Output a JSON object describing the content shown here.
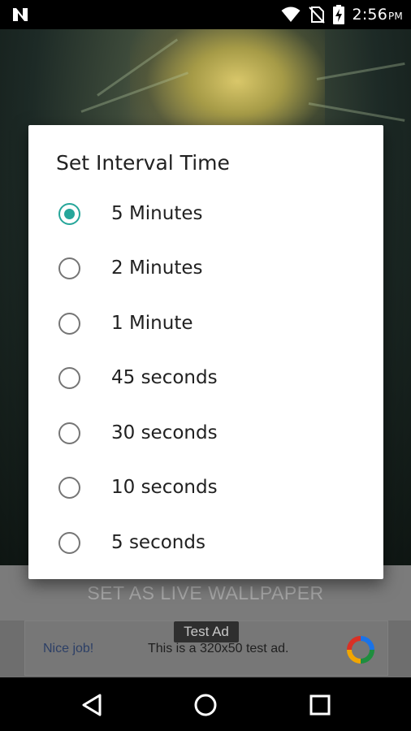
{
  "status_bar": {
    "time": "2:56",
    "ampm": "PM",
    "icons": [
      "notification-n-icon",
      "wifi-icon",
      "no-sim-icon",
      "battery-charging-icon"
    ]
  },
  "wallpaper_button": {
    "label": "SET AS LIVE WALLPAPER"
  },
  "ad": {
    "tag": "Test Ad",
    "headline": "Nice job!",
    "text": "This is a 320x50 test ad."
  },
  "dialog": {
    "title": "Set Interval Time",
    "accent_color": "#26a69a",
    "options": [
      {
        "label": "5 Minutes",
        "checked": true
      },
      {
        "label": "2 Minutes",
        "checked": false
      },
      {
        "label": "1 Minute",
        "checked": false
      },
      {
        "label": "45 seconds",
        "checked": false
      },
      {
        "label": "30 seconds",
        "checked": false
      },
      {
        "label": "10 seconds",
        "checked": false
      },
      {
        "label": "5 seconds",
        "checked": false
      }
    ]
  },
  "nav_bar": {
    "icons": [
      "back-icon",
      "home-icon",
      "recents-icon"
    ]
  }
}
